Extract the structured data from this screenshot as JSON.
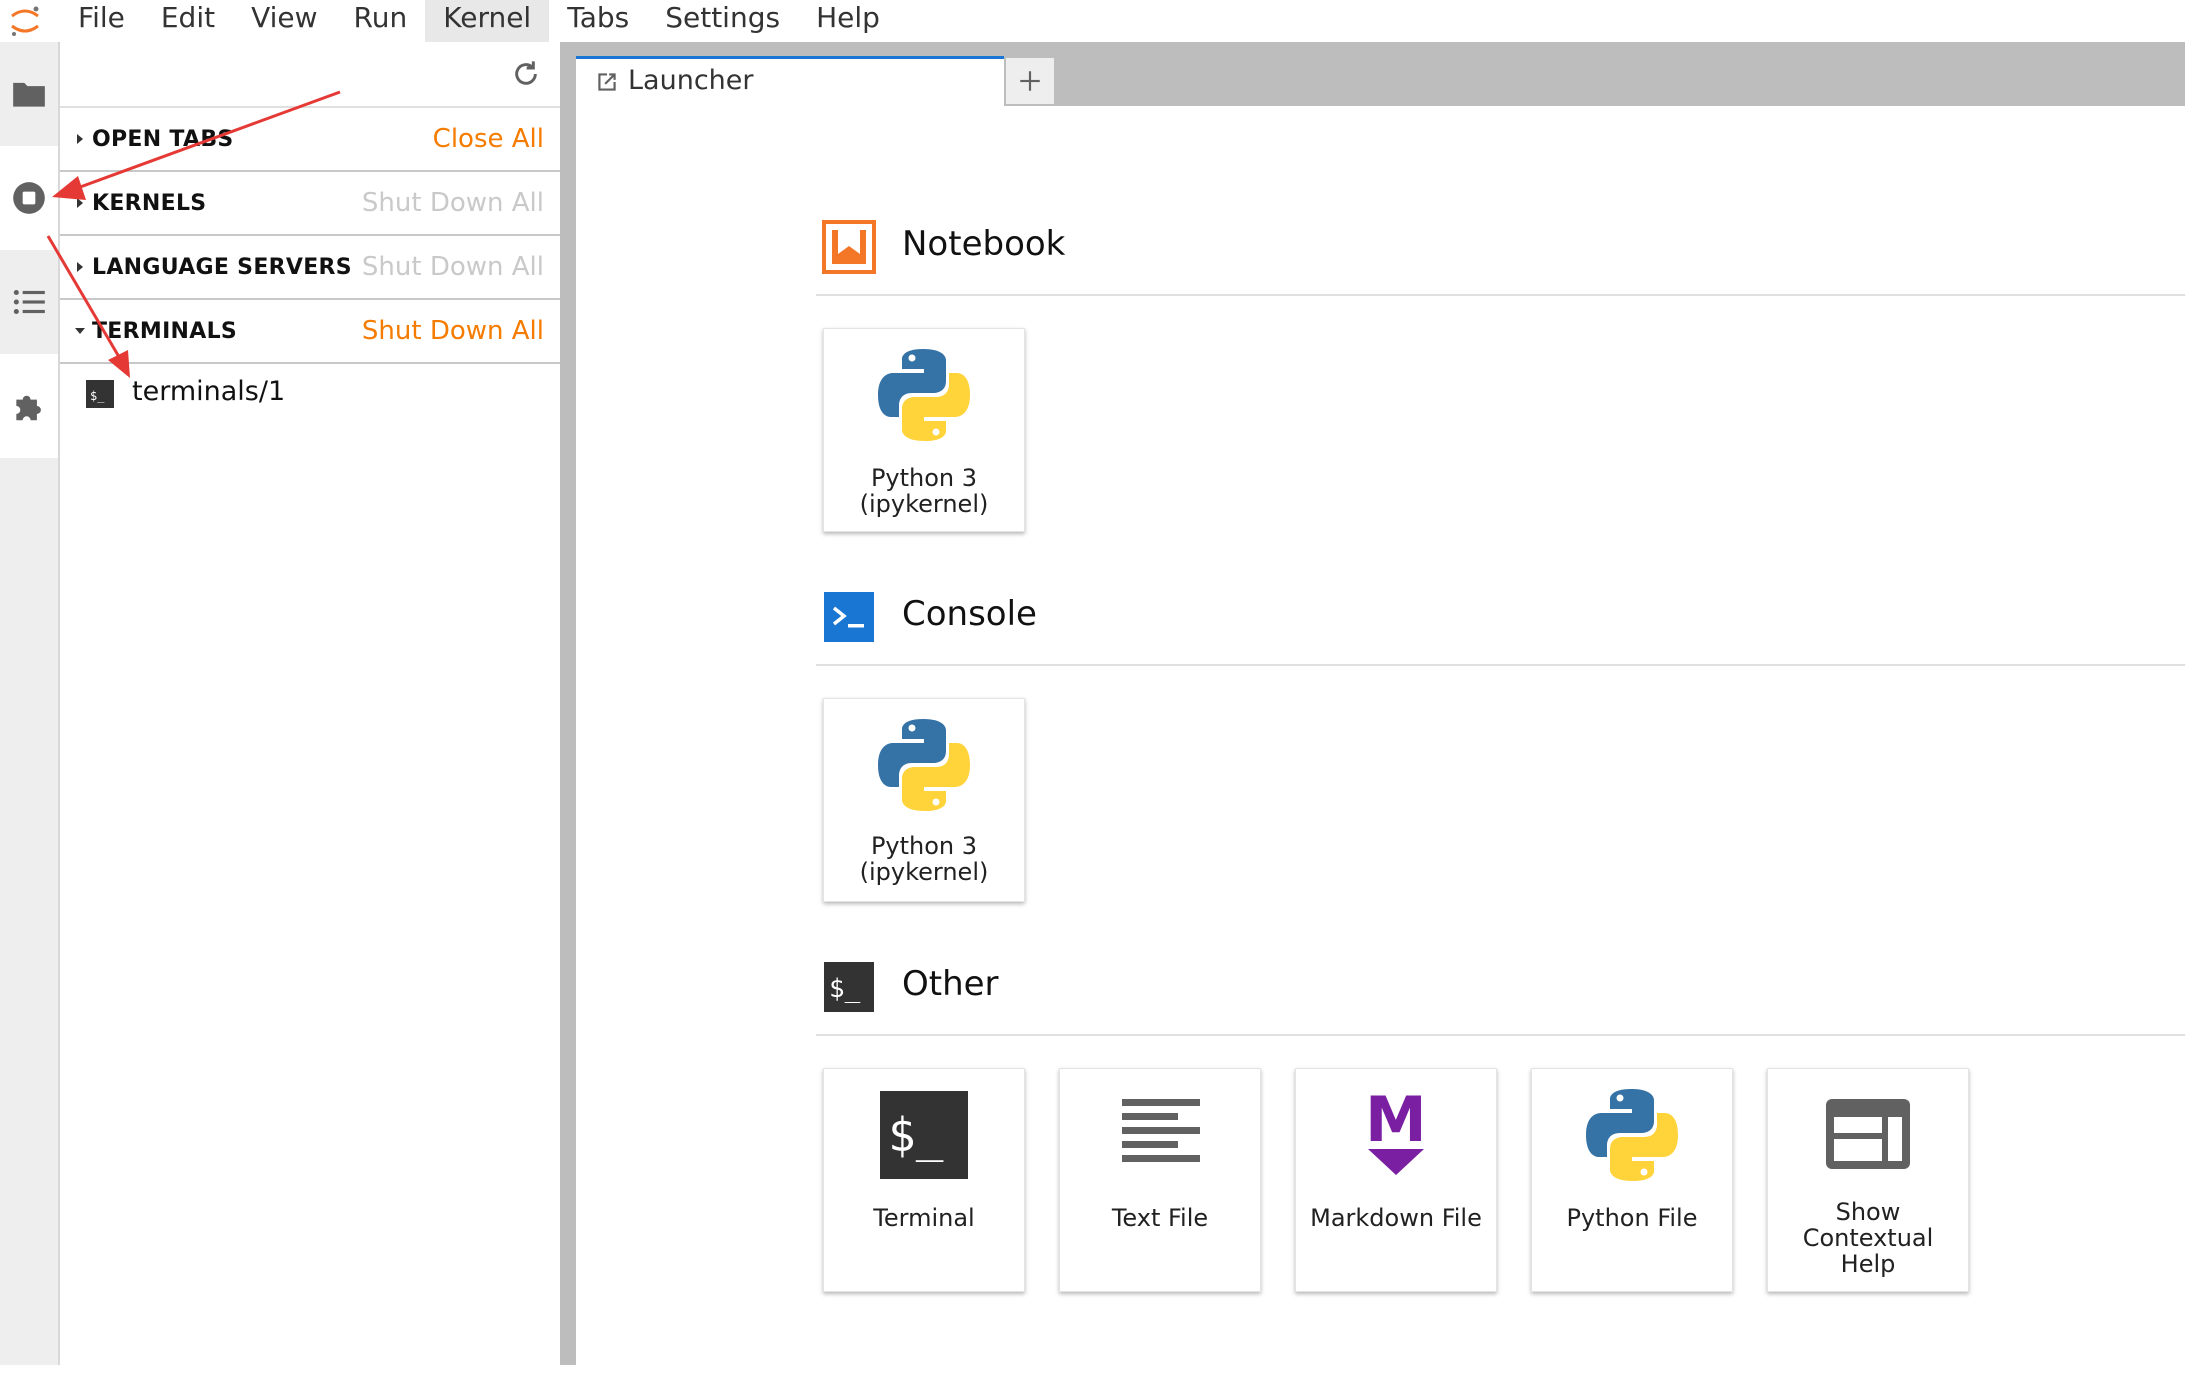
{
  "menu": [
    "File",
    "Edit",
    "View",
    "Run",
    "Kernel",
    "Tabs",
    "Settings",
    "Help"
  ],
  "activity_bar": {
    "items": [
      "folder-icon",
      "running-icon",
      "list-icon",
      "extension-icon"
    ]
  },
  "running_panel": {
    "sections": [
      {
        "label": "OPEN TABS",
        "action": "Close All"
      },
      {
        "label": "KERNELS",
        "action": "Shut Down All"
      },
      {
        "label": "LANGUAGE SERVERS",
        "action": "Shut Down All"
      },
      {
        "label": "TERMINALS",
        "action": "Shut Down All"
      }
    ],
    "terminal_item": "terminals/1",
    "terminal_item_icon_text": "$_"
  },
  "tabs": {
    "launcher_label": "Launcher"
  },
  "launcher": {
    "notebook": {
      "title": "Notebook",
      "cards": [
        {
          "line1": "Python 3",
          "line2": "(ipykernel)"
        }
      ]
    },
    "console": {
      "title": "Console",
      "cards": [
        {
          "line1": "Python 3",
          "line2": "(ipykernel)"
        }
      ]
    },
    "other": {
      "title": "Other",
      "cards": [
        {
          "line1": "Terminal"
        },
        {
          "line1": "Text File"
        },
        {
          "line1": "Markdown File"
        },
        {
          "line1": "Python File"
        },
        {
          "line1": "Show",
          "line2": "Contextual",
          "line3": "Help"
        }
      ]
    }
  },
  "colors": {
    "accent_orange": "#f57c00",
    "tab_blue": "#1976d2",
    "console_blue": "#1976d2",
    "markdown_purple": "#7b1fa2",
    "annotation_red": "#e53935"
  }
}
